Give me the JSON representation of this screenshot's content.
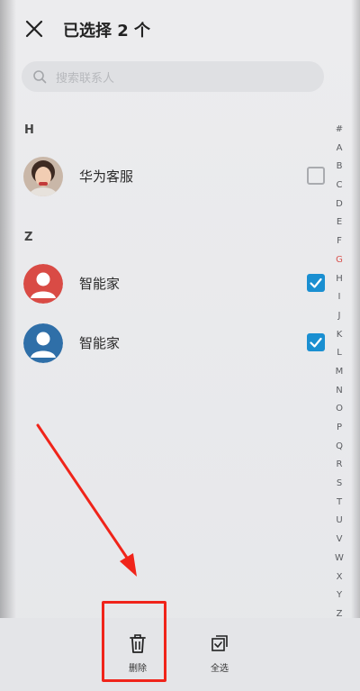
{
  "header": {
    "close_icon": "close-icon",
    "title": "已选择 2 个"
  },
  "search": {
    "placeholder": "搜索联系人",
    "icon": "search-icon"
  },
  "sections": [
    {
      "letter": "H",
      "contacts": [
        {
          "name": "华为客服",
          "avatar": "photo-avatar",
          "checked": false
        }
      ]
    },
    {
      "letter": "Z",
      "contacts": [
        {
          "name": "智能家",
          "avatar": "person-avatar",
          "avatar_color": "#d94b45",
          "checked": true
        },
        {
          "name": "智能家",
          "avatar": "person-avatar",
          "avatar_color": "#2f6fa8",
          "checked": true
        }
      ]
    }
  ],
  "index_letters": [
    "#",
    "A",
    "B",
    "C",
    "D",
    "E",
    "F",
    "G",
    "H",
    "I",
    "J",
    "K",
    "L",
    "M",
    "N",
    "O",
    "P",
    "Q",
    "R",
    "S",
    "T",
    "U",
    "V",
    "W",
    "X",
    "Y",
    "Z"
  ],
  "bottom_bar": {
    "delete": {
      "label": "删除",
      "icon": "trash-icon"
    },
    "select_all": {
      "label": "全选",
      "icon": "select-all-icon"
    }
  },
  "colors": {
    "accent": "#1a8fd1",
    "annotation": "#f0241a"
  }
}
